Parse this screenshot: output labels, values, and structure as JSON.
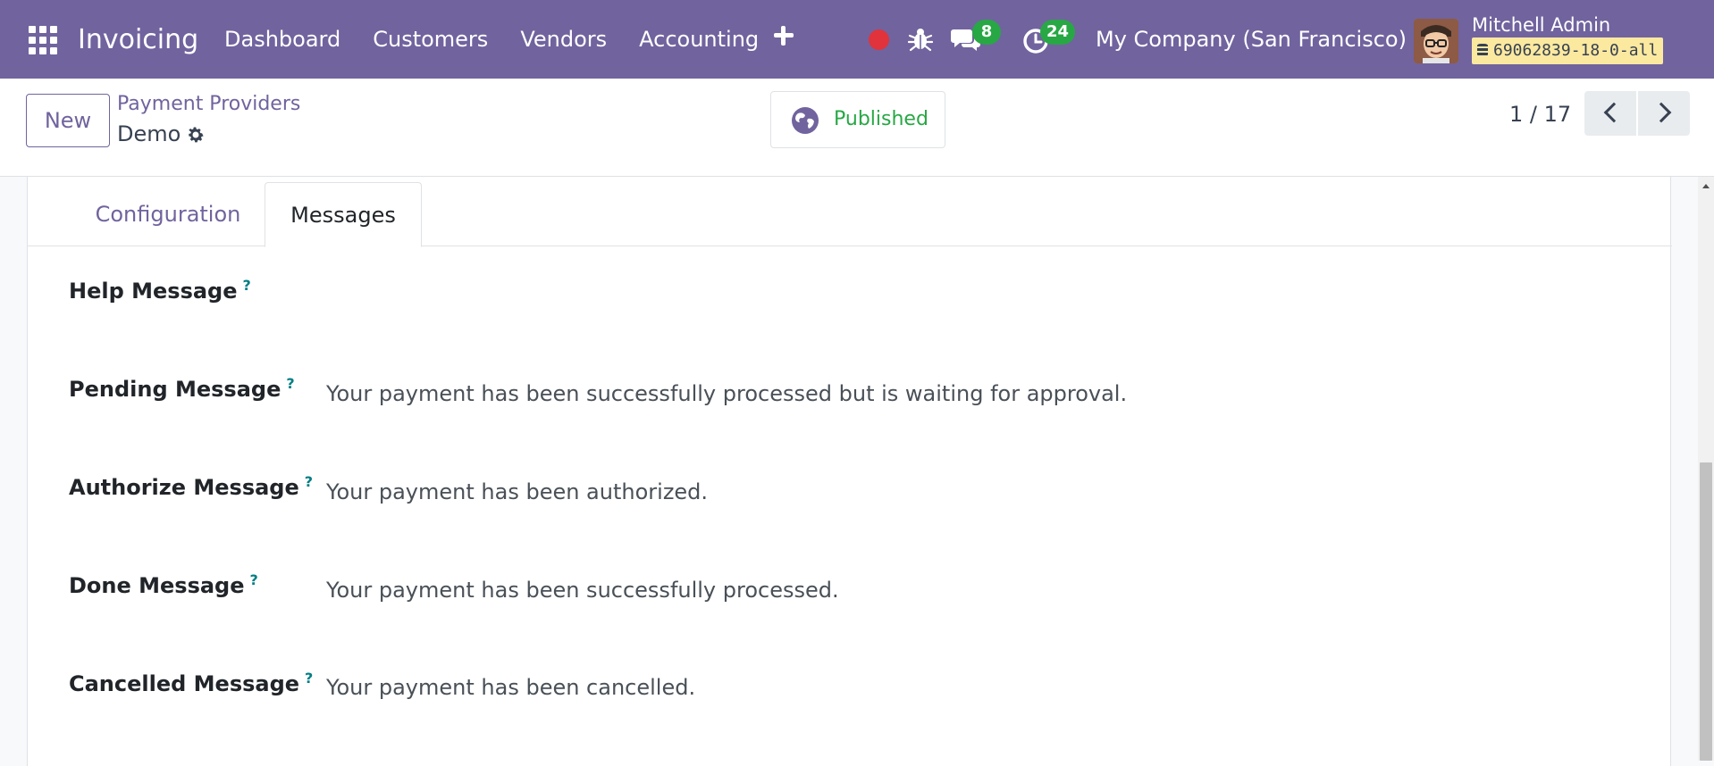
{
  "navbar": {
    "app_name": "Invoicing",
    "menu": [
      "Dashboard",
      "Customers",
      "Vendors",
      "Accounting"
    ],
    "messages_count": "8",
    "activities_count": "24",
    "company": "My Company (San Francisco)",
    "user_name": "Mitchell Admin",
    "database": "69062839-18-0-all"
  },
  "control_panel": {
    "new_label": "New",
    "breadcrumb_parent": "Payment Providers",
    "record_name": "Demo",
    "published_label": "Published",
    "pager": "1 / 17"
  },
  "tabs": [
    {
      "label": "Configuration",
      "active": false
    },
    {
      "label": "Messages",
      "active": true
    }
  ],
  "fields": [
    {
      "label": "Help Message",
      "value": ""
    },
    {
      "label": "Pending Message",
      "value": "Your payment has been successfully processed but is waiting for approval."
    },
    {
      "label": "Authorize Message",
      "value": "Your payment has been authorized."
    },
    {
      "label": "Done Message",
      "value": "Your payment has been successfully processed."
    },
    {
      "label": "Cancelled Message",
      "value": "Your payment has been cancelled."
    }
  ],
  "help_marker": "?",
  "colors": {
    "navbar": "#71639e",
    "badge": "#28a745",
    "published": "#28a745",
    "record_dot": "#e0333c"
  }
}
